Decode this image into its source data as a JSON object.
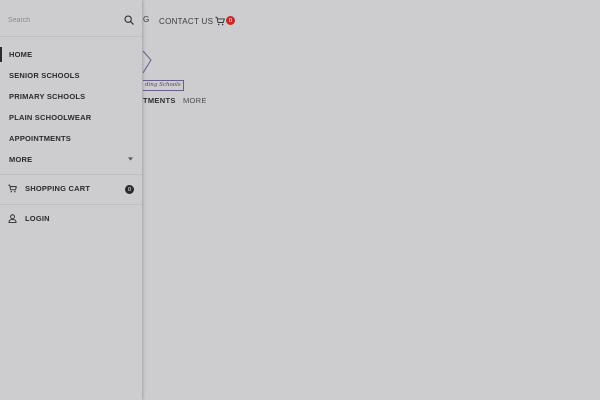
{
  "background": {
    "nav_partial": "G",
    "contact_label": "CONTACT US",
    "cart_count": "0",
    "tagline_partial": "ding Schools",
    "tab_partial": "TMENTS",
    "tab_more": "MORE"
  },
  "drawer": {
    "search": {
      "placeholder": "Search",
      "value": ""
    },
    "menu": [
      {
        "label": "HOME",
        "active": true
      },
      {
        "label": "SENIOR SCHOOLS"
      },
      {
        "label": "PRIMARY SCHOOLS"
      },
      {
        "label": "PLAIN SCHOOLWEAR"
      },
      {
        "label": "APPOINTMENTS"
      },
      {
        "label": "MORE",
        "has_chevron": true
      }
    ],
    "cart": {
      "label": "SHOPPING CART",
      "count": "0"
    },
    "login": {
      "label": "LOGIN"
    }
  },
  "colors": {
    "overlay_bg": "#cdcdcf",
    "text": "#2b2b2b",
    "cart_badge_bg": "#c62828",
    "tagline_accent": "#4f4272"
  },
  "icons": {
    "search": "search-icon",
    "chevron": "chevron-down-icon",
    "cart": "shopping-cart-icon",
    "login": "user-icon"
  }
}
